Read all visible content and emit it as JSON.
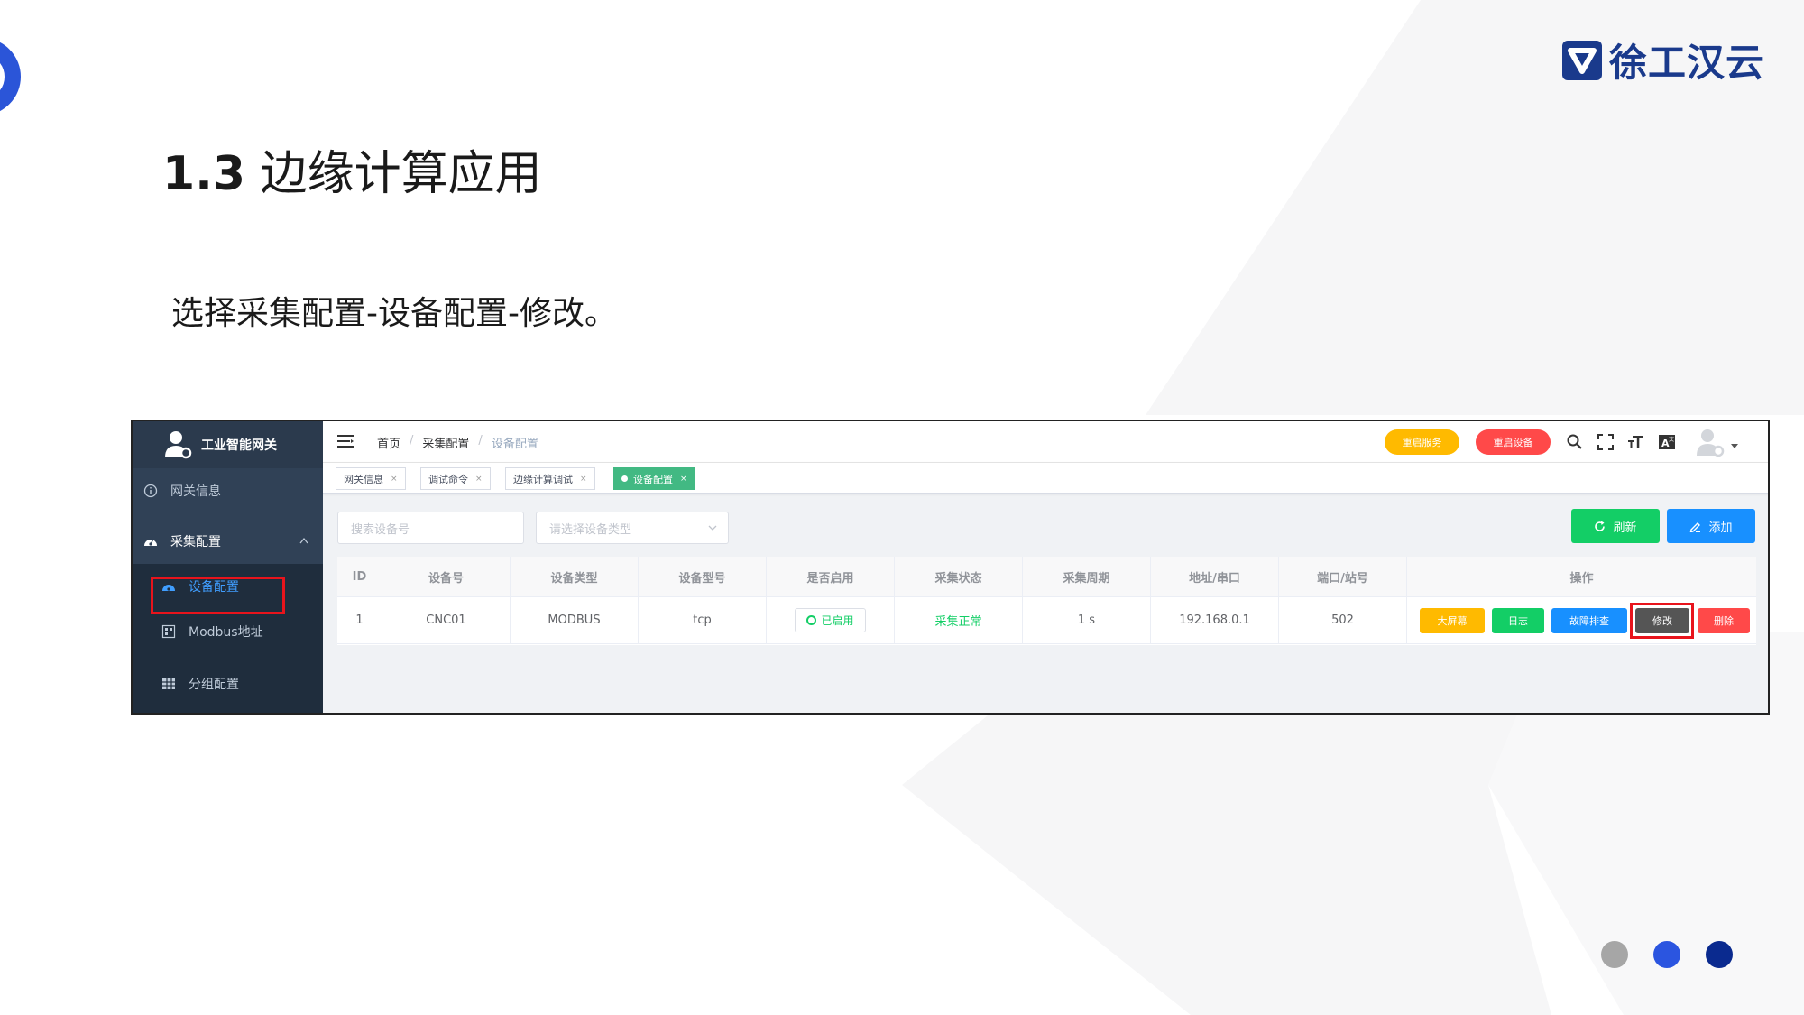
{
  "slide": {
    "brand_name": "徐工汉云",
    "title_number": "1.3",
    "title_text": "边缘计算应用",
    "instruction": "选择采集配置-设备配置-修改。",
    "colors": {
      "brand": "#1a3a8c",
      "accent": "#2b55d8",
      "dot_grey": "#a6a6a6",
      "dot_blue": "#2b55e0",
      "dot_navy": "#0a2a8f"
    }
  },
  "app": {
    "sidebar": {
      "title": "工业智能网关",
      "items": [
        {
          "label": "网关信息",
          "icon": "info-icon"
        },
        {
          "label": "采集配置",
          "icon": "dashboard-icon"
        }
      ],
      "sub_items": [
        {
          "label": "设备配置",
          "icon": "dashboard-icon"
        },
        {
          "label": "Modbus地址",
          "icon": "grid-icon"
        },
        {
          "label": "分组配置",
          "icon": "table-icon"
        }
      ]
    },
    "navbar": {
      "breadcrumb": [
        "首页",
        "采集配置",
        "设备配置"
      ],
      "breadcrumb_sep": "/",
      "restart_service": "重启服务",
      "restart_device": "重启设备",
      "icons": [
        "search-icon",
        "fullscreen-icon",
        "font-size-icon",
        "language-icon",
        "avatar",
        "caret-down-icon"
      ]
    },
    "tabs": [
      {
        "label": "网关信息",
        "close": "×"
      },
      {
        "label": "调试命令",
        "close": "×"
      },
      {
        "label": "边缘计算调试",
        "close": "×"
      },
      {
        "label": "设备配置",
        "close": "×",
        "active": true
      }
    ],
    "filters": {
      "search_placeholder": "搜索设备号",
      "type_placeholder": "请选择设备类型"
    },
    "actions": {
      "refresh": "刷新",
      "add": "添加"
    },
    "table": {
      "headers": [
        "ID",
        "设备号",
        "设备类型",
        "设备型号",
        "是否启用",
        "采集状态",
        "采集周期",
        "地址/串口",
        "端口/站号",
        "操作"
      ],
      "rows": [
        {
          "id": "1",
          "device_no": "CNC01",
          "device_type": "MODBUS",
          "model": "tcp",
          "enabled": "已启用",
          "status": "采集正常",
          "period": "1 s",
          "address": "192.168.0.1",
          "port": "502"
        }
      ],
      "row_actions": [
        "大屏幕",
        "日志",
        "故障排查",
        "修改",
        "删除"
      ]
    }
  }
}
